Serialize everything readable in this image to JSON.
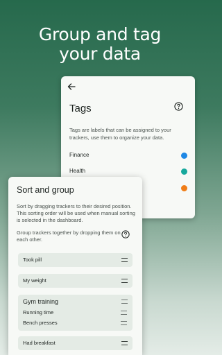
{
  "headline": {
    "line1": "Group and tag",
    "line2": "your data"
  },
  "tags_screen": {
    "back_icon": "arrow-left-icon",
    "title": "Tags",
    "help_icon": "help-circle-icon",
    "description": "Tags are labels that can be assigned to your trackers, use them to organize your data.",
    "tags": [
      {
        "label": "Finance",
        "color": "#1e88e5"
      },
      {
        "label": "Health",
        "color": "#16a89c"
      },
      {
        "label": "",
        "color": "#f07d17"
      }
    ]
  },
  "sort_screen": {
    "title": "Sort and group",
    "sort_description": "Sort by dragging trackers to their desired position. This sorting order will be used when manual sorting is selected in the dashboard.",
    "group_description": "Group trackers together by dropping them on each other.",
    "help_icon": "help-circle-icon",
    "trackers": [
      {
        "label": "Took pill"
      },
      {
        "label": "My weight"
      }
    ],
    "group": {
      "title": "Gym training",
      "items": [
        {
          "label": "Running time"
        },
        {
          "label": "Bench presses"
        }
      ]
    },
    "last_tracker": {
      "label": "Had breakfast"
    }
  },
  "colors": {
    "accent_green": "#26694c",
    "card_bg": "#f7f9f6",
    "row_bg": "#e4ebe5"
  }
}
